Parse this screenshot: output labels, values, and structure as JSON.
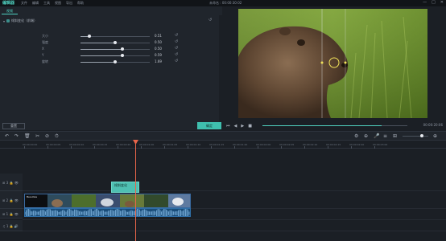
{
  "app": {
    "logo": "编辑器",
    "title": "未命名 : 00:00:30:02"
  },
  "menu": [
    "文件",
    "编辑",
    "工具",
    "视图",
    "导出",
    "帮助"
  ],
  "window_controls": {
    "min": "—",
    "max": "□",
    "close": "✕"
  },
  "tabs": [
    {
      "label": "视频"
    }
  ],
  "effect_section": {
    "title": "倾斜变化（前端）",
    "reset_icon": "↺"
  },
  "params": [
    {
      "label": "大小",
      "value": "0.51",
      "level": 0.13
    },
    {
      "label": "强度",
      "value": "0.50",
      "level": 0.5
    },
    {
      "label": "X",
      "value": "0.50",
      "level": 0.6
    },
    {
      "label": "Y",
      "value": "0.59",
      "level": 0.6
    },
    {
      "label": "旋转",
      "value": "1.69",
      "level": 0.5
    }
  ],
  "buttons": {
    "reset": "重置",
    "ok": "确定"
  },
  "preview": {
    "timecode": "00:00:20:06",
    "progress": 0.82,
    "controls": [
      "⏮",
      "◀",
      "▶",
      "■"
    ],
    "right_controls": [
      "⤢",
      "📷",
      "🔊",
      "⛶"
    ]
  },
  "toolbar": {
    "left_tools": [
      "↶",
      "↷",
      "🗑",
      "✂",
      "⊘",
      "⏱"
    ],
    "right_tools": [
      "⚙",
      "⊕",
      "🎤",
      "≡",
      "⊞",
      "⊖",
      "⊕"
    ]
  },
  "ruler": {
    "ticks": [
      "00:00:00:00",
      "00:00:00:05",
      "00:00:00:10",
      "00:00:00:15",
      "00:00:00:20",
      "00:00:01:00",
      "00:00:01:05",
      "00:00:01:10",
      "00:00:01:15",
      "00:00:01:20",
      "00:00:02:00",
      "00:00:02:05",
      "00:00:02:10",
      "00:00:02:15",
      "00:00:02:20",
      "00:00:03:00"
    ]
  },
  "tracks": [
    {
      "label": "⊞ 3 🔒 👁"
    },
    {
      "label": "⊞ 2 🔒 👁"
    },
    {
      "label": "⊞ 1 🔒 👁"
    },
    {
      "label": "♫ 1 🔒 🔊"
    }
  ],
  "clips": {
    "text_clip": "倾斜变化",
    "video_clip": "Beauties",
    "colors": {
      "text_clip": "#4fc0b2",
      "video_clip": "#1c3146",
      "audio_clip": "#1a4d7a",
      "playhead": "#e8654a",
      "accent": "#4fd1c0"
    }
  }
}
